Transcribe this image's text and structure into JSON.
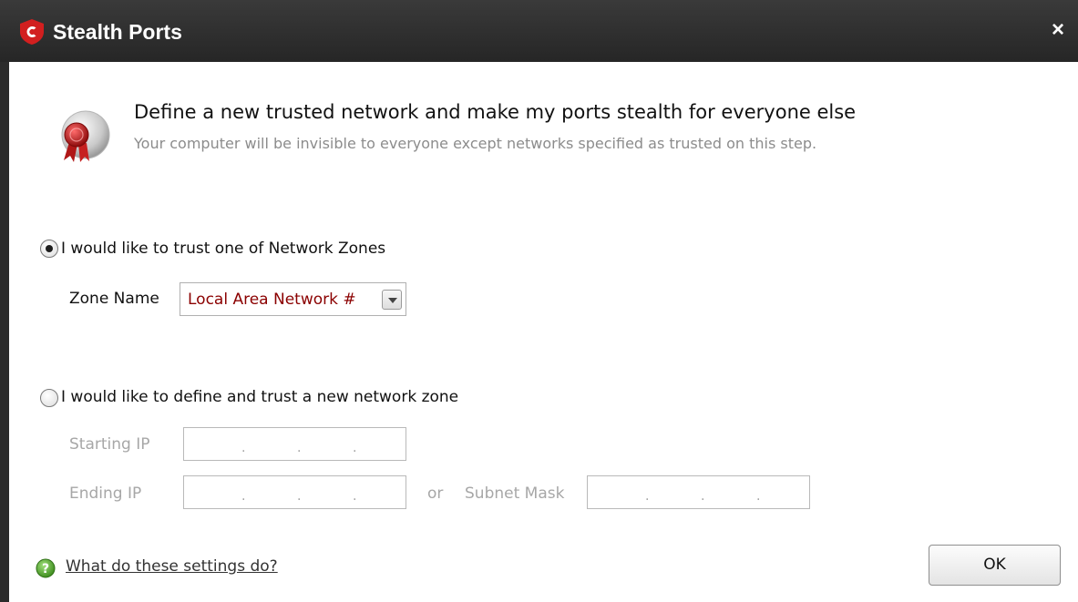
{
  "window": {
    "title": "Stealth Ports",
    "close_label": "×"
  },
  "header": {
    "title": "Define a new trusted network and make my ports stealth for everyone else",
    "subtitle": "Your computer will be invisible to everyone except networks specified as trusted on this step."
  },
  "option_zone": {
    "label": "I would like to trust one of Network Zones",
    "checked": true,
    "zone_name_label": "Zone Name",
    "zone_name_value": "Local Area Network #"
  },
  "option_new": {
    "label": "I would like to define and trust a new network zone",
    "checked": false,
    "starting_ip_label": "Starting IP",
    "ending_ip_label": "Ending IP",
    "or_label": "or",
    "subnet_mask_label": "Subnet Mask",
    "ip_separator": "."
  },
  "footer": {
    "help_link": "What do these settings do?",
    "ok_label": "OK"
  },
  "colors": {
    "titlebar": "#2e2e2e",
    "logo_red": "#d21f1f",
    "zone_value": "#8b0000",
    "disabled_text": "#a7a7a7",
    "help_green": "#5aa832"
  }
}
